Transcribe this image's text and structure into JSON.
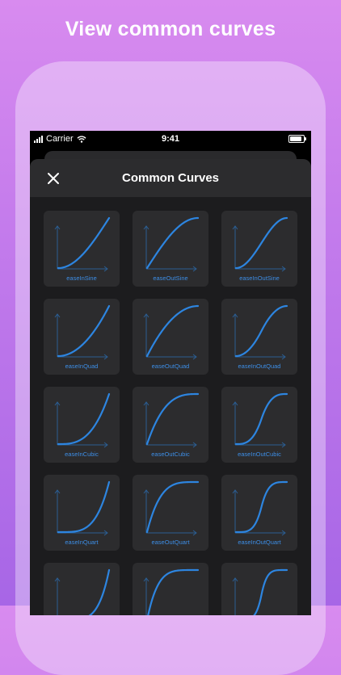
{
  "headline": "View common curves",
  "status_bar": {
    "carrier": "Carrier",
    "time": "9:41"
  },
  "nav": {
    "title": "Common Curves"
  },
  "curve_color": "#2d85e0",
  "axis_color": "#2b5e93",
  "tiles": [
    {
      "label": "easeInSine",
      "ease": "inSine"
    },
    {
      "label": "easeOutSine",
      "ease": "outSine"
    },
    {
      "label": "easeInOutSine",
      "ease": "inOutSine"
    },
    {
      "label": "easeInQuad",
      "ease": "inQuad"
    },
    {
      "label": "easeOutQuad",
      "ease": "outQuad"
    },
    {
      "label": "easeInOutQuad",
      "ease": "inOutQuad"
    },
    {
      "label": "easeInCubic",
      "ease": "inCubic"
    },
    {
      "label": "easeOutCubic",
      "ease": "outCubic"
    },
    {
      "label": "easeInOutCubic",
      "ease": "inOutCubic"
    },
    {
      "label": "easeInQuart",
      "ease": "inQuart"
    },
    {
      "label": "easeOutQuart",
      "ease": "outQuart"
    },
    {
      "label": "easeInOutQuart",
      "ease": "inOutQuart"
    },
    {
      "label": "",
      "ease": "inQuint"
    },
    {
      "label": "",
      "ease": "outQuint"
    },
    {
      "label": "",
      "ease": "inOutQuint"
    }
  ]
}
